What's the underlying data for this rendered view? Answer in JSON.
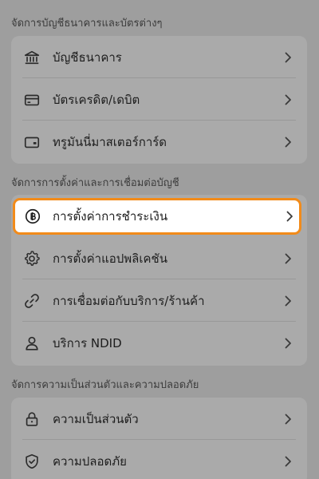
{
  "sections": [
    {
      "header": "จัดการบัญชีธนาคารและบัตรต่างๆ",
      "items": [
        {
          "label": "บัญชีธนาคาร",
          "icon": "bank-icon"
        },
        {
          "label": "บัตรเครดิต/เดบิต",
          "icon": "credit-card-icon"
        },
        {
          "label": "ทรูมันนี่มาสเตอร์การ์ด",
          "icon": "wallet-card-icon"
        }
      ]
    },
    {
      "header": "จัดการการตั้งค่าและการเชื่อมต่อบัญชี",
      "items": [
        {
          "label": "การตั้งค่าการชำระเงิน",
          "icon": "baht-coin-icon",
          "highlighted": true
        },
        {
          "label": "การตั้งค่าแอปพลิเคชัน",
          "icon": "gear-icon"
        },
        {
          "label": "การเชื่อมต่อกับบริการ/ร้านค้า",
          "icon": "link-icon"
        },
        {
          "label": "บริการ NDID",
          "icon": "person-icon"
        }
      ]
    },
    {
      "header": "จัดการความเป็นส่วนตัวและความปลอดภัย",
      "items": [
        {
          "label": "ความเป็นส่วนตัว",
          "icon": "lock-icon"
        },
        {
          "label": "ความปลอดภัย",
          "icon": "shield-check-icon"
        }
      ]
    }
  ],
  "colors": {
    "highlight_border": "#f28b1a",
    "overlay_background": "#9e9e9e"
  }
}
